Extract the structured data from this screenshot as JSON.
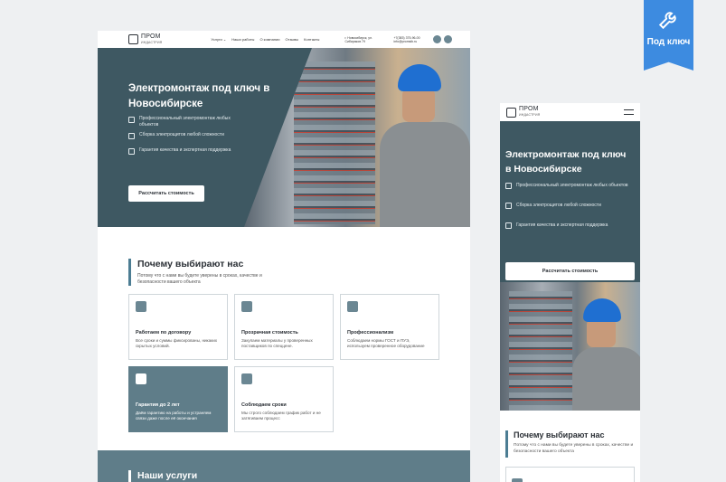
{
  "badge": {
    "label": "Под ключ",
    "icon": "wrench-icon",
    "color": "#3d8be0"
  },
  "brand": {
    "name": "ПРОМ",
    "sub": "ИНДАСТРИЯ"
  },
  "desktop": {
    "menu": [
      "Услуги ⌄",
      "Наши работы",
      "О компании",
      "Отзывы",
      "Контакты"
    ],
    "address": "г. Новосибирск, ул. Сибиряков 79",
    "phone": "+7(383) 375-96-00",
    "email": "info@promsib.ru",
    "hero_title": "Электромонтаж под ключ в Новосибирске",
    "features": [
      "Профессиональный электромонтаж любых объектов",
      "Сборка электрощитов любой сложности",
      "Гарантия качества и экспертная поддержка"
    ],
    "cta": "Рассчитать стоимость",
    "why_title": "Почему выбирают нас",
    "why_text": "Потому что с нами вы будете уверены в сроках, качестве и безопасности вашего объекта",
    "cards": [
      {
        "title": "Работаем по договору",
        "text": "Все сроки и суммы фиксированы, никаких скрытых условий."
      },
      {
        "title": "Прозрачная стоимость",
        "text": "Закупаем материалы у проверенных поставщиков по спеццене."
      },
      {
        "title": "Профессионализм",
        "text": "Соблюдаем нормы ГОСТ и ПУЭ, используем проверенное оборудование"
      },
      {
        "title": "Гарантия до 2 лет",
        "text": "Даём гарантию на работы и устраняем связи даже после её окончания"
      },
      {
        "title": "Соблюдаем сроки",
        "text": "Мы строго соблюдаем график работ и не затягиваем процесс"
      }
    ],
    "services_title": "Наши услуги"
  },
  "mobile": {
    "hero_title": "Электромонтаж под ключ в Новосибирске",
    "features": [
      "Профессиональный электромонтаж любых объектов",
      "Сборка электрощитов любой сложности",
      "Гарантия качества и экспертная поддержка"
    ],
    "cta": "Рассчитать стоимость",
    "why_title": "Почему выбирают нас",
    "why_text": "Потому что с нами вы будете уверены в сроках, качестве и безопасности вашего объекта"
  },
  "colors": {
    "primary": "#3e5862",
    "accent": "#5f7d89",
    "background": "#eef0f2"
  }
}
